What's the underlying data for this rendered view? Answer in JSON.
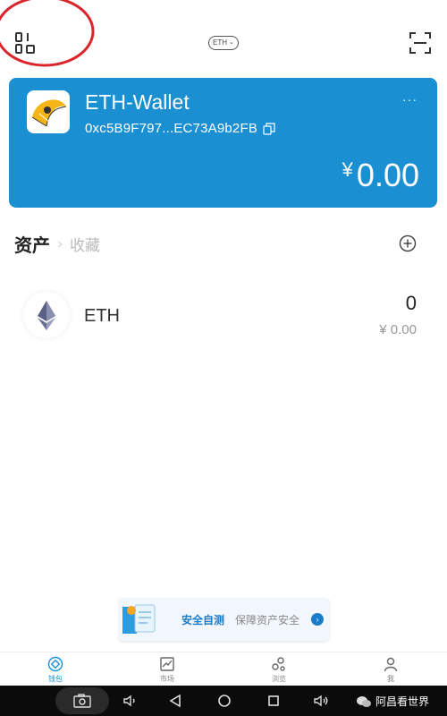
{
  "header": {
    "chain_label": "ETH",
    "menu_icon": "qr-grid-icon",
    "scan_icon": "scan-icon",
    "annotation_color": "#d9252b"
  },
  "wallet": {
    "name": "ETH-Wallet",
    "address": "0xc5B9F797...EC73A9b2FB",
    "more": "···",
    "currency_symbol": "¥",
    "balance": "0.00",
    "card_color": "#1a90d3"
  },
  "tabs": {
    "assets": "资产",
    "favorites": "收藏"
  },
  "assets": [
    {
      "symbol": "ETH",
      "amount": "0",
      "value": "¥ 0.00"
    }
  ],
  "banner": {
    "title": "安全自测",
    "subtitle": "保障资产安全"
  },
  "bottom_nav": [
    {
      "label": "钱包",
      "icon": "wallet-icon",
      "active": true
    },
    {
      "label": "市场",
      "icon": "market-icon",
      "active": false
    },
    {
      "label": "浏览",
      "icon": "browse-icon",
      "active": false
    },
    {
      "label": "我",
      "icon": "profile-icon",
      "active": false
    }
  ],
  "watermark": "阿昌看世界"
}
